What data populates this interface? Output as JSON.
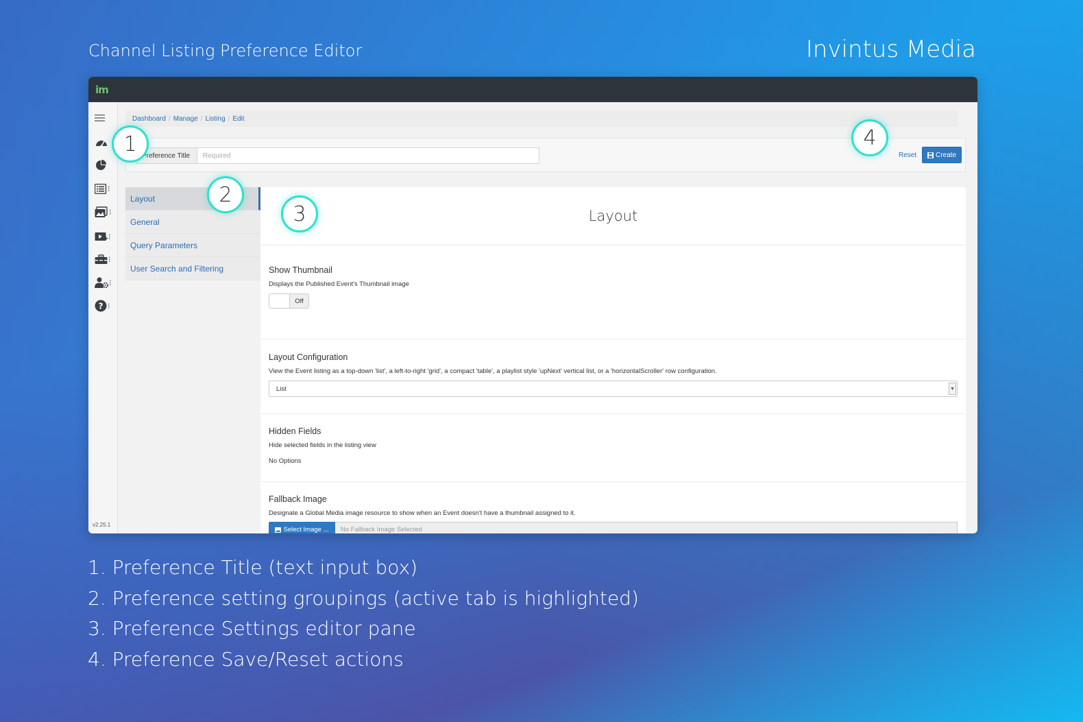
{
  "page": {
    "title": "Channel Listing Preference Editor",
    "brand": "Invintus Media"
  },
  "app": {
    "logo": "im",
    "version": "v2.25.1",
    "sidebar_icons": [
      "menu-icon",
      "dashboard-gauge-icon",
      "pie-chart-icon",
      "list-icon",
      "media-icon",
      "video-add-icon",
      "toolbox-icon",
      "user-settings-icon",
      "help-icon"
    ],
    "breadcrumb": [
      "Dashboard",
      "Manage",
      "Listing",
      "Edit"
    ],
    "preference_title": {
      "label": "Preference Title",
      "placeholder": "Required",
      "value": ""
    },
    "actions": {
      "reset": "Reset",
      "create": "Create"
    },
    "tabs": [
      {
        "label": "Layout",
        "active": true
      },
      {
        "label": "General",
        "active": false
      },
      {
        "label": "Query Parameters",
        "active": false
      },
      {
        "label": "User Search and Filtering",
        "active": false
      }
    ],
    "editor": {
      "heading": "Layout",
      "show_thumbnail": {
        "title": "Show Thumbnail",
        "description": "Displays the Published Event's Thumbnail image",
        "toggle": "Off"
      },
      "layout_configuration": {
        "title": "Layout Configuration",
        "description": "View the Event listing as a top-down 'list', a left-to-right 'grid', a compact 'table', a playlist style 'upNext' vertical list, or a 'horizontalScroller' row configuration.",
        "selected": "List"
      },
      "hidden_fields": {
        "title": "Hidden Fields",
        "description": "Hide selected fields in the listing view",
        "options": "No Options"
      },
      "fallback_image": {
        "title": "Fallback Image",
        "description": "Designate a Global Media image resource to show when an Event doesn't have a thumbnail assigned to it.",
        "button": "Select Image ...",
        "value": "No Fallback Image Selected"
      }
    }
  },
  "callouts": [
    "1",
    "2",
    "3",
    "4"
  ],
  "legend": [
    "1. Preference Title (text input box)",
    "2. Preference setting groupings (active tab is highlighted)",
    "3. Preference Settings editor pane",
    "4. Preference Save/Reset actions"
  ],
  "colors": {
    "accent": "#2f79c2",
    "callout_ring": "#2ee0cf",
    "topbar": "#2d343c"
  }
}
